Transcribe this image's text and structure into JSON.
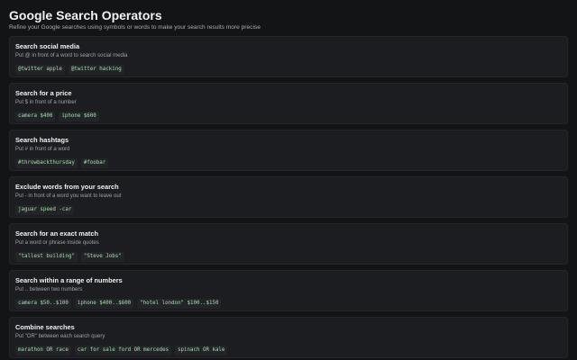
{
  "header": {
    "title": "Google Search Operators",
    "subtitle": "Refine your Google searches using symbols or words to make your search results more precise"
  },
  "operators": [
    {
      "title": "Search social media",
      "description": "Put @ in front of a word to search social media",
      "examples": [
        "@twitter apple",
        "@twitter hacking"
      ]
    },
    {
      "title": "Search for a price",
      "description": "Put $ in front of a number",
      "examples": [
        "camera $400",
        "iphone $600"
      ]
    },
    {
      "title": "Search hashtags",
      "description": "Put # in front of a word",
      "examples": [
        "#throwbackthursday",
        "#foobar"
      ]
    },
    {
      "title": "Exclude words from your search",
      "description": "Put - in front of a word you want to leave out",
      "examples": [
        "jaguar speed -car"
      ]
    },
    {
      "title": "Search for an exact match",
      "description": "Put a word or phrase inside quotes",
      "examples": [
        "\"tallest building\"",
        "\"Steve Jobs\""
      ]
    },
    {
      "title": "Search within a range of numbers",
      "description": "Put .. between two numbers",
      "examples": [
        "camera $50..$100",
        "iphone $400..$600",
        "\"hotel london\" $100..$150"
      ]
    },
    {
      "title": "Combine searches",
      "description": "Put \"OR\" between each search query",
      "examples": [
        "marathon OR race",
        "car for sale ford OR mercedes",
        "spinach OR kale"
      ]
    }
  ],
  "colors": {
    "background": "#131416",
    "card": "#1c1d20",
    "code_text": "#9ee0a8"
  }
}
